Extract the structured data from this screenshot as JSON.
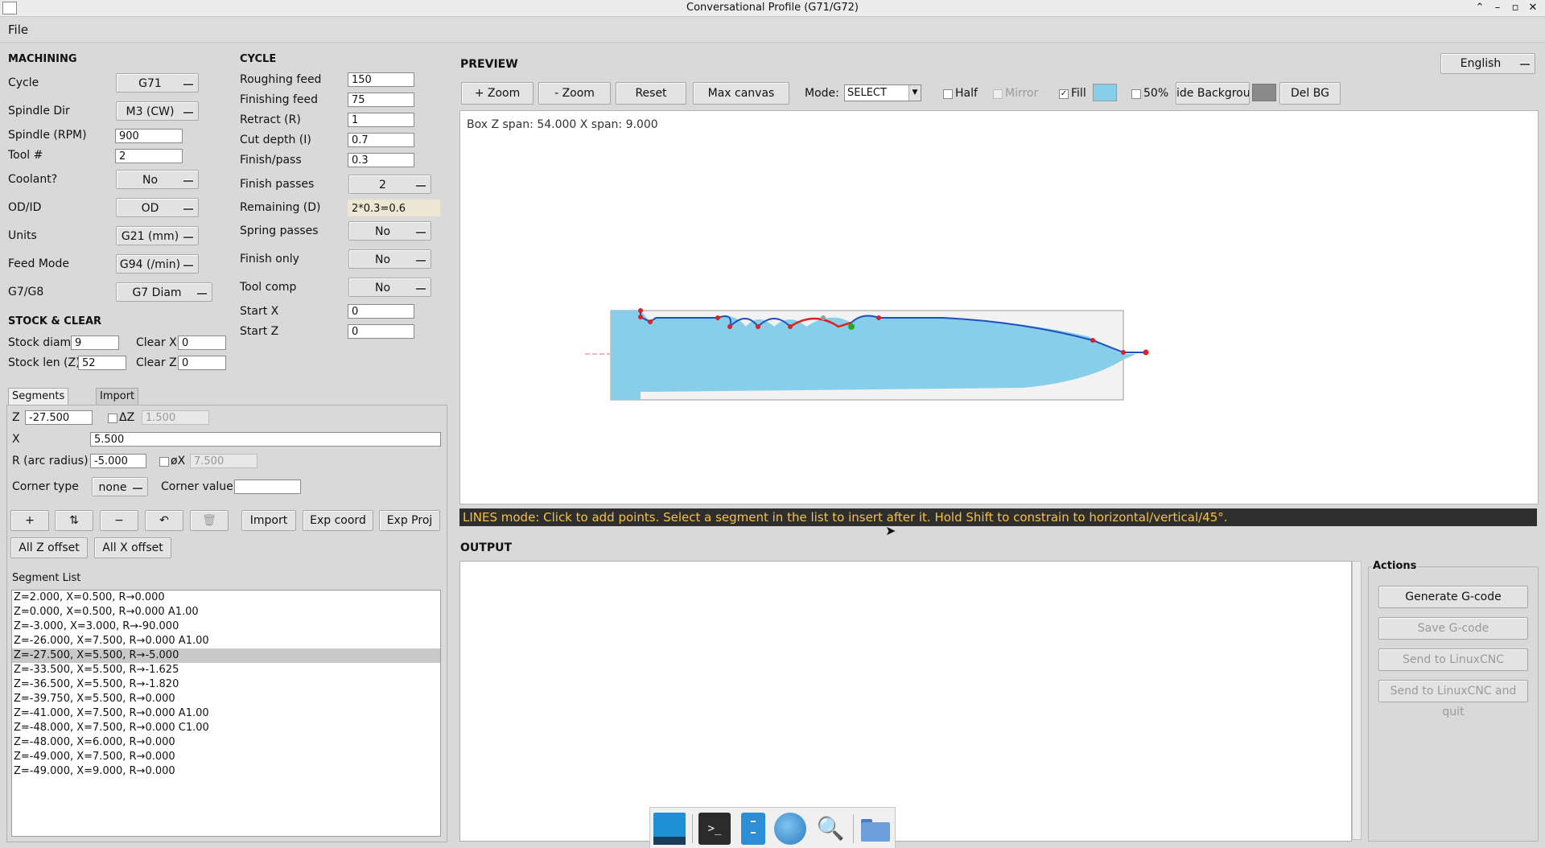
{
  "window": {
    "title": "Conversational Profile (G71/G72)"
  },
  "menu": {
    "file": "File"
  },
  "machining": {
    "header": "MACHINING",
    "cycle_label": "Cycle",
    "cycle_value": "G71",
    "spindle_dir_label": "Spindle Dir",
    "spindle_dir_value": "M3 (CW)",
    "spindle_rpm_label": "Spindle (RPM)",
    "spindle_rpm_value": "900",
    "tool_label": "Tool #",
    "tool_value": "2",
    "coolant_label": "Coolant?",
    "coolant_value": "No",
    "odid_label": "OD/ID",
    "odid_value": "OD",
    "units_label": "Units",
    "units_value": "G21 (mm)",
    "feed_mode_label": "Feed Mode",
    "feed_mode_value": "G94 (/min)",
    "g7g8_label": "G7/G8",
    "g7g8_value": "G7 Diam"
  },
  "cycle": {
    "header": "CYCLE",
    "roughing_feed_label": "Roughing feed",
    "roughing_feed_value": "150",
    "finishing_feed_label": "Finishing feed",
    "finishing_feed_value": "75",
    "retract_label": "Retract (R)",
    "retract_value": "1",
    "cut_depth_label": "Cut depth (I)",
    "cut_depth_value": "0.7",
    "finish_pass_label": "Finish/pass",
    "finish_pass_value": "0.3",
    "finish_passes_label": "Finish passes",
    "finish_passes_value": "2",
    "remaining_label": "Remaining (D)",
    "remaining_value": "2*0.3=0.6",
    "spring_passes_label": "Spring passes",
    "spring_passes_value": "No",
    "finish_only_label": "Finish only",
    "finish_only_value": "No",
    "tool_comp_label": "Tool comp",
    "tool_comp_value": "No",
    "start_x_label": "Start X",
    "start_x_value": "0",
    "start_z_label": "Start Z",
    "start_z_value": "0"
  },
  "stock": {
    "header": "STOCK & CLEAR",
    "stock_diam_label": "Stock diam",
    "stock_diam_value": "9",
    "clear_x_label": "Clear X",
    "clear_x_value": "0",
    "stock_len_label": "Stock len (Z)",
    "stock_len_value": "52",
    "clear_z_label": "Clear Z",
    "clear_z_value": "0"
  },
  "tabs": {
    "segments": "Segments",
    "import": "Import"
  },
  "segment_edit": {
    "z_label": "Z",
    "z_value": "-27.500",
    "dz_label": "ΔZ",
    "dz_value": "1.500",
    "x_label": "X",
    "x_value": "5.500",
    "r_label": "R (arc radius)",
    "r_value": "-5.000",
    "dx_label": "øX",
    "dx_value": "7.500",
    "corner_type_label": "Corner type",
    "corner_type_value": "none",
    "corner_value_label": "Corner value",
    "corner_value_value": ""
  },
  "seg_buttons": {
    "add": "+",
    "swap": "⇅",
    "remove": "−",
    "undo": "↶",
    "delete": "🗑",
    "import": "Import",
    "exp_coord": "Exp coord",
    "exp_proj": "Exp Proj",
    "all_z_offset": "All Z offset",
    "all_x_offset": "All X offset"
  },
  "segment_list": {
    "label": "Segment List",
    "items": [
      "Z=2.000, X=0.500, R→0.000",
      "Z=0.000, X=0.500, R→0.000 A1.00",
      "Z=-3.000, X=3.000, R→-90.000",
      "Z=-26.000, X=7.500, R→0.000 A1.00",
      "Z=-27.500, X=5.500, R→-5.000",
      "Z=-33.500, X=5.500, R→-1.625",
      "Z=-36.500, X=5.500, R→-1.820",
      "Z=-39.750, X=5.500, R→0.000",
      "Z=-41.000, X=7.500, R→0.000 A1.00",
      "Z=-48.000, X=7.500, R→0.000 C1.00",
      "Z=-48.000, X=6.000, R→0.000",
      "Z=-49.000, X=7.500, R→0.000",
      "Z=-49.000, X=9.000, R→0.000"
    ],
    "selected_index": 4
  },
  "preview": {
    "header": "PREVIEW",
    "language": "English",
    "zoom_in": "+ Zoom",
    "zoom_out": "- Zoom",
    "reset": "Reset",
    "max_canvas": "Max canvas",
    "mode_label": "Mode:",
    "mode_value": "SELECT",
    "half": "Half",
    "mirror": "Mirror",
    "fill": "Fill",
    "fifty": "50%",
    "hide_bg": "ide Backgrour",
    "del_bg": "Del BG",
    "box_info": "Box Z span: 54.000  X span: 9.000",
    "fill_color": "#87ceeb",
    "profile_color": "#1f4fbf",
    "selected_color": "#e02020"
  },
  "status": {
    "text": "LINES mode: Click to add points. Select a segment in the list to insert after it. Hold Shift to constrain to horizontal/vertical/45°."
  },
  "output": {
    "header": "OUTPUT"
  },
  "actions": {
    "header": "Actions",
    "generate": "Generate G-code",
    "save": "Save G-code",
    "send": "Send to LinuxCNC",
    "send_quit": "Send to LinuxCNC and quit"
  }
}
